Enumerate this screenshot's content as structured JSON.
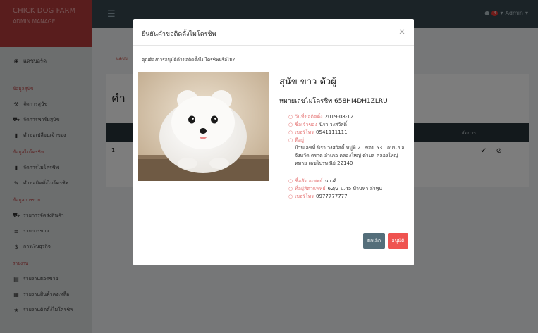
{
  "brand": {
    "title": "CHICK DOG FARM",
    "subtitle": "ADMIN MANAGE"
  },
  "sidebar": {
    "home": "แดชบอร์ด",
    "sections": [
      {
        "heading": "ข้อมูลสุนัข",
        "items": [
          {
            "label": "จัดการสุนัข",
            "icon": "bone-icon",
            "glyph": "⚒"
          },
          {
            "label": "จัดการฟาร์มสุนัข",
            "icon": "car-icon",
            "glyph": "⛟"
          },
          {
            "label": "คำขอเปลี่ยนเจ้าของ",
            "icon": "bookmark-icon",
            "glyph": "▮"
          }
        ]
      },
      {
        "heading": "ข้อมูลไมโครชิพ",
        "items": [
          {
            "label": "จัดการไมโครชิพ",
            "icon": "book-icon",
            "glyph": "▮"
          },
          {
            "label": "คำขอติดตั้งไมโครชิพ",
            "icon": "pencil-icon",
            "glyph": "✎"
          }
        ]
      },
      {
        "heading": "ข้อมูลการขาย",
        "items": [
          {
            "label": "รายการจัดส่งสินค้า",
            "icon": "truck-icon",
            "glyph": "⛟"
          },
          {
            "label": "รายการขาย",
            "icon": "list-icon",
            "glyph": "≣"
          },
          {
            "label": "การเงินธุรกิจ",
            "icon": "dollar-icon",
            "glyph": "$"
          }
        ]
      },
      {
        "heading": "รายงาน",
        "items": [
          {
            "label": "รายงานยอดขาย",
            "icon": "file-icon",
            "glyph": "▤"
          },
          {
            "label": "รายงานสินค้าคงเหลือ",
            "icon": "inventory-icon",
            "glyph": "▦"
          },
          {
            "label": "รายงานติดตั้งไมโครชิพ",
            "icon": "star-icon",
            "glyph": "★"
          }
        ]
      }
    ]
  },
  "navbar": {
    "user": "Admin",
    "notification_count": "4"
  },
  "background": {
    "breadcrumb": "แดชบ",
    "panel_title": "คำ",
    "action_header": "จัดการ",
    "row_number": "1"
  },
  "modal": {
    "title": "ยืนยันคำขอติดตั้งไมโครชิพ",
    "question": "คุณต้องการอนุมัติคำขอติดตั้งไมโครชิพหรือไม่?",
    "dog_name": "สุนัข ขาว ตัวผู้",
    "chip_label": "หมายเลขไมโครชิพ",
    "chip_number": "658HI4DH1ZLRU",
    "install_date_label": "วันที่ขอติดตั้ง",
    "install_date": "2019-08-12",
    "owner_label": "ชื่อเจ้าของ",
    "owner": "นิรา วงสวัสดิ์",
    "phone_label": "เบอร์โทร",
    "phone": "0541111111",
    "address_label": "ที่อยู่",
    "address": "บ้านเลขที่ นิรา วงสวัสดิ์ หมู่ที่ 21 ซอย 531 ถนน ปอ จังหวัด ตราด อำเภอ คลองใหญ่ ตำบล คลองใหญ่ หมาย เลขไปรษณีย์ 22140",
    "vet_label": "ชื่อสัตวแพทย์",
    "vet": "นาวลี",
    "vet_address_label": "ที่อยู่สัตวแพทย์",
    "vet_address": "62/2 ม.45 บ้านทา ลำพูน",
    "vet_phone_label": "เบอร์โทร",
    "vet_phone": "0977777777",
    "cancel_label": "ยกเลิก",
    "approve_label": "อนุมัติ",
    "close_glyph": "×"
  },
  "colors": {
    "brand_red": "#b33a3a",
    "navbar": "#37474f",
    "approve": "#ef5350",
    "cancel": "#546e7a",
    "label_red": "#e57373"
  }
}
